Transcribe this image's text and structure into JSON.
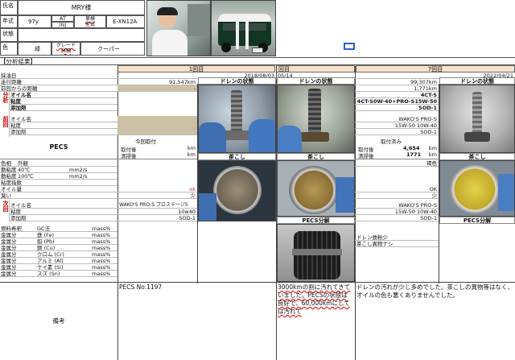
{
  "header": {
    "name_label": "氏名",
    "owner": "MRY様",
    "model_year_label": "年式",
    "model_year": "97y",
    "trans_at": "AT",
    "trans_inj": "INJ",
    "chassis": "車検\n型式",
    "chassis_code": "E-XN12A",
    "condition_label": "状態",
    "color_label": "色",
    "color_value": "緑",
    "grade_label": "グレード\n詳細",
    "grade_value": "クーパー"
  },
  "section_title": "【分析結果】",
  "columns": {
    "col1_title": "1回目",
    "col2_title": "回目",
    "col3_title": "7回目",
    "col2_date_frag": "05/14",
    "col3_date": "2022/04/21",
    "col1_date": "2018/08/03"
  },
  "labels": {
    "sample_date": "採油日",
    "mileage": "走行距離",
    "distance_prev": "前回からの距離",
    "analysis_group": "分析",
    "oil_name": "オイル名",
    "viscosity": "粘度",
    "additive": "添加剤",
    "prev_group": "前回",
    "prev_oil_name": "オイル名",
    "prev_viscosity": "粘度",
    "prev_additive": "添加剤",
    "pecs": "PECS",
    "color_row": "色相",
    "appearance": "外観",
    "viscosity_40": "動粘度",
    "temp_40": "40℃",
    "viscosity_100": "動粘度",
    "temp_100": "100℃",
    "visc_unit": "mm2/s",
    "viscosity_index": "粘度指数",
    "oil_amount": "オイル量",
    "smell": "臭い",
    "next_group": "次回",
    "next_oil_name": "オイル名",
    "next_viscosity": "粘度",
    "next_additive": "添加剤",
    "fuel_dilution": "燃料希釈",
    "gc_method": "GC法",
    "mass_unit": "mass%",
    "metals": [
      {
        "label": "金属分",
        "element": "鉄 (Fe)"
      },
      {
        "label": "金属分",
        "element": "鉛 (Pb)"
      },
      {
        "label": "金属分",
        "element": "銅 (Cu)"
      },
      {
        "label": "金属分",
        "element": "クロム (Cr)"
      },
      {
        "label": "金属分",
        "element": "アルミ (Al)"
      },
      {
        "label": "金属分",
        "element": "ケイ素 (Si)"
      },
      {
        "label": "金属分",
        "element": "スズ (Sn)"
      }
    ],
    "remarks": "備考"
  },
  "col1": {
    "mileage": "91,547km",
    "distance_prev": "-",
    "pecs_title": "今回取付",
    "install_after": "取付後",
    "wash_after": "清掃後",
    "km": "km",
    "amount_fragment": "ok",
    "smell_fragment": "少",
    "next_oil": "WAKO'S PRO-S プロステージS",
    "next_visc": "10w40",
    "next_add": "SOD-1",
    "remarks": "PECS No.1197"
  },
  "col2": {
    "drain_title": "ドレンの状態",
    "strainer_title": "茶こし",
    "pecs_title": "PECS分解",
    "remarks": "3000kmの割に汚れてきていました。PECSの状態は良好で、60,000kmにしては汚れて"
  },
  "col3": {
    "mileage": "99,307km",
    "distance_prev": "1,771km",
    "oil_name": "4CT-S",
    "viscosity": "4CT-S0W-40+PRO-S15W-50",
    "additive": "SOD-1",
    "prev_oil": "WAKO'S PRO-S",
    "prev_visc": "15W-50 10W-40",
    "prev_add": "SOD-1",
    "pecs_title": "取付済み",
    "install_after": "取付後",
    "install_km": "4,654",
    "wash_after": "清掃後",
    "wash_km": "1771",
    "km": "km",
    "color_frag": "褐色",
    "amount_frag": "OK",
    "smell_frag": "少",
    "next_oil": "WAKO'S PRO-S",
    "next_visc": "15W-50 10W-40",
    "next_add": "SOD-1",
    "drain_title": "ドレンの状態",
    "strainer_title": "茶こし",
    "pecs_title2": "PECS分解",
    "drain_note1": "ドレン鉄粉少",
    "drain_note2": "茶こし異物ナシ",
    "remarks": "ドレンの汚れが少し多めでした。茶こしの異物等はなく、オイルの色も悪くありませんでした。"
  },
  "col1_photo_titles": {
    "drain": "ドレンの状態",
    "strainer": "茶こし"
  }
}
